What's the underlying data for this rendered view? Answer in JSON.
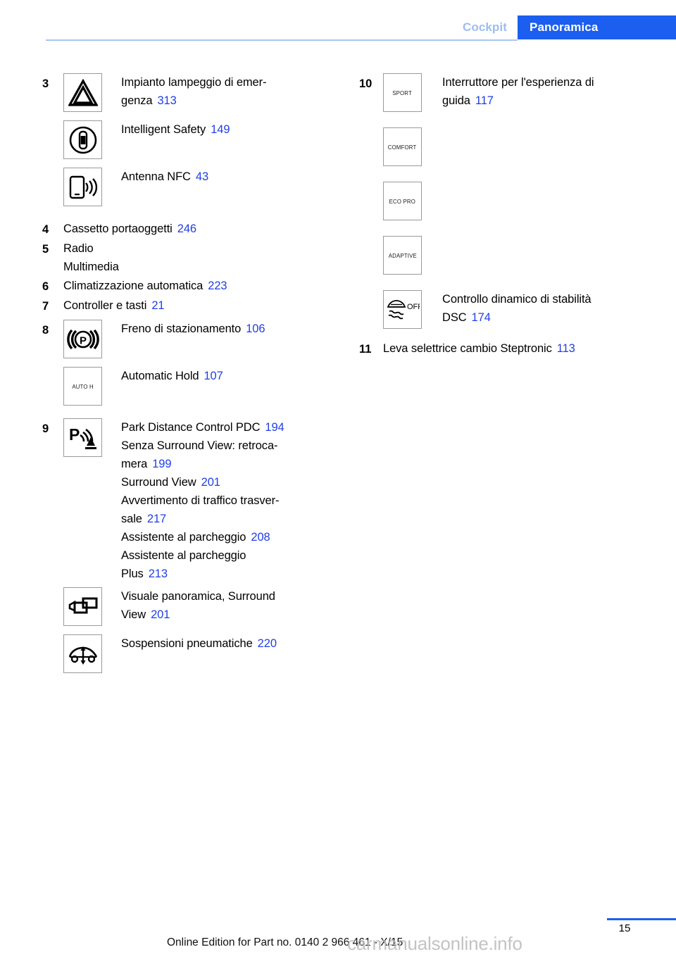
{
  "header": {
    "tab_inactive": "Cockpit",
    "tab_active": "Panoramica",
    "accent_color": "#1b5ef0",
    "inactive_color": "#9dbdf0"
  },
  "reference_color": "#1f3fe6",
  "left_column": {
    "items": [
      {
        "num": "3",
        "icon": "hazard-warning-triangle-icon",
        "lines": [
          {
            "text": "Impianto lampeggio di emer-",
            "page": ""
          },
          {
            "text": "genza",
            "page": "313"
          }
        ]
      },
      {
        "num": "",
        "icon": "intelligent-safety-car-circle-icon",
        "lines": [
          {
            "text": "Intelligent Safety",
            "page": "149"
          }
        ]
      },
      {
        "num": "",
        "icon": "nfc-antenna-icon",
        "lines": [
          {
            "text": "Antenna NFC",
            "page": "43"
          }
        ]
      },
      {
        "num": "4",
        "icon": "",
        "lines": [
          {
            "text": "Cassetto portaoggetti",
            "page": "246"
          }
        ]
      },
      {
        "num": "5",
        "icon": "",
        "lines": [
          {
            "text": "Radio",
            "page": ""
          },
          {
            "text": "Multimedia",
            "page": ""
          }
        ]
      },
      {
        "num": "6",
        "icon": "",
        "lines": [
          {
            "text": "Climatizzazione automatica",
            "page": "223"
          }
        ]
      },
      {
        "num": "7",
        "icon": "",
        "lines": [
          {
            "text": "Controller e tasti",
            "page": "21"
          }
        ]
      },
      {
        "num": "8",
        "icon": "parking-brake-icon",
        "lines": [
          {
            "text": "Freno di stazionamento",
            "page": "106"
          }
        ]
      },
      {
        "num": "",
        "icon": "auto-hold-icon",
        "icon_text": "AUTO H",
        "lines": [
          {
            "text": "Automatic Hold",
            "page": "107"
          }
        ]
      },
      {
        "num": "9",
        "icon": "park-distance-control-icon",
        "lines": [
          {
            "text": "Park Distance Control PDC",
            "page": "194"
          },
          {
            "text": "Senza Surround View: retroca-",
            "page": ""
          },
          {
            "text": "mera",
            "page": "199"
          },
          {
            "text": "Surround View",
            "page": "201"
          },
          {
            "text": "Avvertimento di traffico trasver-",
            "page": ""
          },
          {
            "text": "sale",
            "page": "217"
          },
          {
            "text": "Assistente al parcheggio",
            "page": "208"
          },
          {
            "text": "Assistente al parcheggio",
            "page": ""
          },
          {
            "text": "Plus",
            "page": "213"
          }
        ]
      },
      {
        "num": "",
        "icon": "surround-view-camera-icon",
        "lines": [
          {
            "text": "Visuale panoramica, Surround",
            "page": ""
          },
          {
            "text": "View",
            "page": "201"
          }
        ]
      },
      {
        "num": "",
        "icon": "air-suspension-icon",
        "lines": [
          {
            "text": "Sospensioni pneumatiche",
            "page": "220"
          }
        ]
      }
    ]
  },
  "right_column": {
    "items": [
      {
        "num": "10",
        "icon": "sport-mode-icon",
        "icon_text": "SPORT",
        "lines": [
          {
            "text": "Interruttore per l'esperienza di",
            "page": ""
          },
          {
            "text": "guida",
            "page": "117"
          }
        ]
      },
      {
        "num": "",
        "icon": "comfort-mode-icon",
        "icon_text": "COMFORT",
        "lines": []
      },
      {
        "num": "",
        "icon": "eco-pro-mode-icon",
        "icon_text": "ECO PRO",
        "lines": []
      },
      {
        "num": "",
        "icon": "adaptive-mode-icon",
        "icon_text": "ADAPTIVE",
        "lines": []
      },
      {
        "num": "",
        "icon": "dsc-off-icon",
        "icon_text": "OFF",
        "lines": [
          {
            "text": "Controllo dinamico di stabilità",
            "page": ""
          },
          {
            "text": "DSC",
            "page": "174"
          }
        ]
      },
      {
        "num": "11",
        "icon": "",
        "lines": [
          {
            "text": "Leva selettrice cambio Steptronic",
            "page": "113"
          }
        ]
      }
    ]
  },
  "footer": {
    "page_number": "15",
    "edition": "Online Edition for Part no. 0140 2 966 461 - X/15",
    "watermark": "carmanualsonline.info"
  }
}
